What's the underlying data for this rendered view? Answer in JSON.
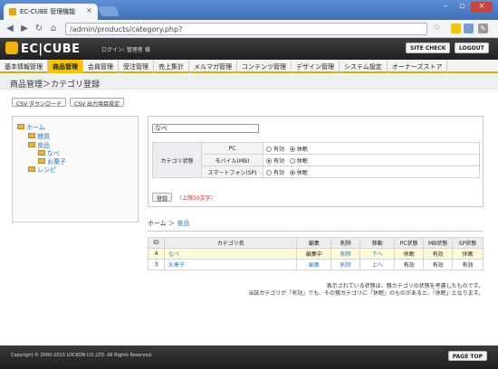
{
  "browser": {
    "tab_title": "EC-CUBE 管理機能",
    "url_prefix": "",
    "url_path": "/admin/products/category.php?"
  },
  "header": {
    "logo": "EC|CUBE",
    "login_text": "ログイン: 管理者 様",
    "site_check": "SITE CHECK",
    "logout": "LOGOUT"
  },
  "menu": [
    "基本情報管理",
    "商品管理",
    "会員管理",
    "受注管理",
    "売上集計",
    "メルマガ管理",
    "コンテンツ管理",
    "デザイン管理",
    "システム設定",
    "オーナーズストア"
  ],
  "page_title": "商品管理＞カテゴリ登録",
  "buttons": {
    "csv_download": "CSV ダウンロード",
    "csv_settings": "CSV 出力項目設定",
    "save": "登録",
    "save_note": "（上限50文字）"
  },
  "tree": {
    "root": "ホーム",
    "n1": "雑貨",
    "n2": "食品",
    "n3": "なべ",
    "n4": "お菓子",
    "n5": "レシピ"
  },
  "form": {
    "name_value": "なべ",
    "status_label": "カテゴリ状態",
    "devices": [
      "PC",
      "モバイル(MB)",
      "スマートフォン(SP)"
    ],
    "opt_on": "有効",
    "opt_off": "休眠"
  },
  "breadcrumb": {
    "home": "ホーム",
    "sep": "＞",
    "current": "食品"
  },
  "table": {
    "headers": [
      "ID",
      "カテゴリ名",
      "編集",
      "削除",
      "移動",
      "PC状態",
      "MB状態",
      "SP状態"
    ],
    "rows": [
      {
        "id": "4",
        "name": "なべ",
        "edit": "編集中",
        "del": "削除",
        "move": "下へ",
        "pc": "休眠",
        "mb": "有効",
        "sp": "休眠"
      },
      {
        "id": "3",
        "name": "お菓子",
        "edit": "編集",
        "del": "削除",
        "move": "上へ",
        "pc": "有効",
        "mb": "有効",
        "sp": "有効"
      }
    ]
  },
  "notes": {
    "line1": "表示されている状態は、親カテゴリの状態を考慮したものです。",
    "line2": "当該カテゴリが「有効」でも、その親カテゴリに「休眠」のものがあると、「休眠」となります。"
  },
  "footer": {
    "copyright": "Copyright © 2000-2013 LOCKON CO.,LTD. All Rights Reserved.",
    "page_top": "PAGE TOP"
  }
}
